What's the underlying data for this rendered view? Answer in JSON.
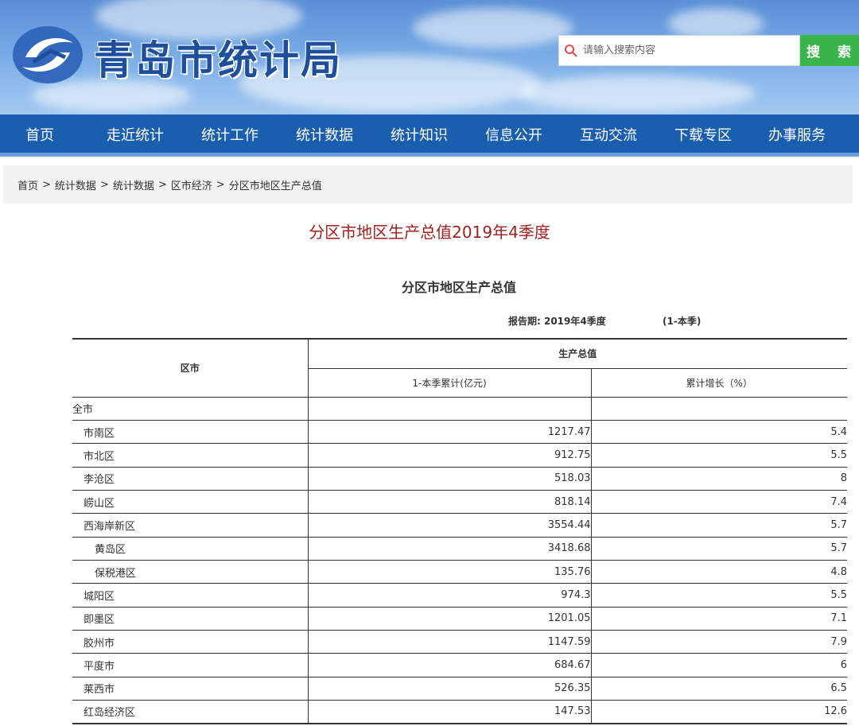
{
  "header": {
    "site_title": "青岛市统计局",
    "search": {
      "placeholder": "请输入搜索内容",
      "button_label": "搜 索"
    }
  },
  "nav": {
    "items": [
      {
        "label": "首页"
      },
      {
        "label": "走近统计"
      },
      {
        "label": "统计工作"
      },
      {
        "label": "统计数据"
      },
      {
        "label": "统计知识"
      },
      {
        "label": "信息公开"
      },
      {
        "label": "互动交流"
      },
      {
        "label": "下载专区"
      },
      {
        "label": "办事服务"
      }
    ]
  },
  "breadcrumb": {
    "items": [
      "首页",
      "统计数据",
      "统计数据",
      "区市经济",
      "分区市地区生产总值"
    ],
    "separator": ">"
  },
  "page": {
    "title": "分区市地区生产总值2019年4季度",
    "table_title": "分区市地区生产总值",
    "report_period": "报告期: 2019年4季度",
    "report_range": "(1-本季)"
  },
  "table": {
    "col_region": "区市",
    "col_group": "生产总值",
    "col_value": "1-本季累计(亿元)",
    "col_growth": "累计增长（%）",
    "rows": [
      {
        "name": "全市",
        "value": "",
        "growth": ""
      },
      {
        "name": "市南区",
        "value": "1217.47",
        "growth": "5.4"
      },
      {
        "name": "市北区",
        "value": "912.75",
        "growth": "5.5"
      },
      {
        "name": "李沧区",
        "value": "518.03",
        "growth": "8"
      },
      {
        "name": "崂山区",
        "value": "818.14",
        "growth": "7.4"
      },
      {
        "name": "西海岸新区",
        "value": "3554.44",
        "growth": "5.7"
      },
      {
        "name": "黄岛区",
        "value": "3418.68",
        "growth": "5.7"
      },
      {
        "name": "保税港区",
        "value": "135.76",
        "growth": "4.8"
      },
      {
        "name": "城阳区",
        "value": "974.3",
        "growth": "5.5"
      },
      {
        "name": "即墨区",
        "value": "1201.05",
        "growth": "7.1"
      },
      {
        "name": "胶州市",
        "value": "1147.59",
        "growth": "7.9"
      },
      {
        "name": "平度市",
        "value": "684.67",
        "growth": "6"
      },
      {
        "name": "莱西市",
        "value": "526.35",
        "growth": "6.5"
      },
      {
        "name": "红岛经济区",
        "value": "147.53",
        "growth": "12.6"
      }
    ]
  },
  "colors": {
    "nav_bg": "#1a5eb0",
    "search_button": "#39b54a",
    "page_title": "#a02020",
    "banner_sky": "#6fa3e2"
  }
}
